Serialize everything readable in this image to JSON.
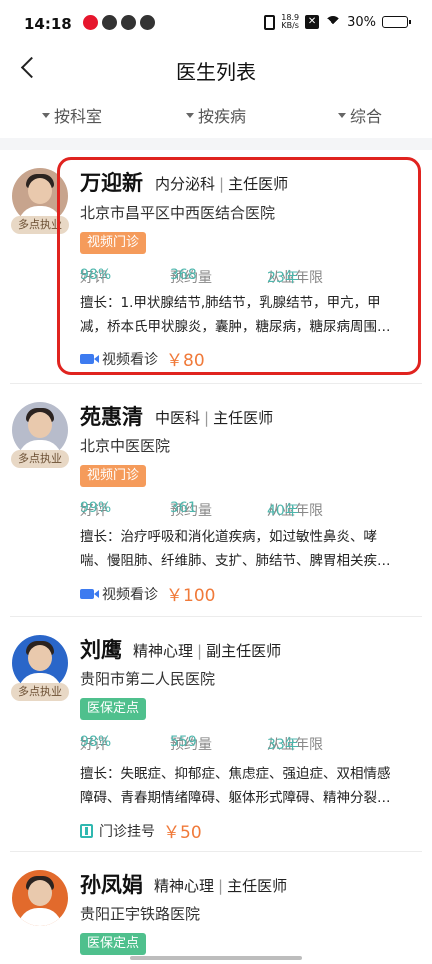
{
  "status_bar": {
    "time": "14:18",
    "net_speed": "18.9",
    "net_unit": "KB/s",
    "battery": "30%",
    "battery_level": 0.3
  },
  "header": {
    "title": "医生列表"
  },
  "filters": [
    {
      "label": "按科室"
    },
    {
      "label": "按疾病"
    },
    {
      "label": "综合"
    }
  ],
  "doctors": [
    {
      "name": "万迎新",
      "department": "内分泌科",
      "title": "主任医师",
      "hospital": "北京市昌平区中西医结合医院",
      "badge": "多点执业",
      "tag": "视频门诊",
      "rating_label": "好评",
      "rating": "98%",
      "appointments_label": "预约量",
      "appointments": "368",
      "years_label": "从业年限",
      "years": "23年",
      "specialty_line1": "擅长：1.甲状腺结节,肺结节，乳腺结节，甲亢，甲",
      "specialty_line2": "减，桥本氏甲状腺炎，囊肿，糖尿病，糖尿病周围…",
      "consult_label": "视频看诊",
      "price": "￥80"
    },
    {
      "name": "苑惠清",
      "department": "中医科",
      "title": "主任医师",
      "hospital": "北京中医医院",
      "badge": "多点执业",
      "tag": "视频门诊",
      "rating_label": "好评",
      "rating": "99%",
      "appointments_label": "预约量",
      "appointments": "361",
      "years_label": "从业年限",
      "years": "40年",
      "specialty_line1": "擅长：治疗呼吸和消化道疾病，如过敏性鼻炎、哮",
      "specialty_line2": "喘、慢阻肺、纤维肺、支扩、肺结节、脾胃相关疾…",
      "consult_label": "视频看诊",
      "price": "￥100"
    },
    {
      "name": "刘鹰",
      "department": "精神心理",
      "title": "副主任医师",
      "hospital": "贵阳市第二人民医院",
      "badge": "多点执业",
      "tag": "医保定点",
      "rating_label": "好评",
      "rating": "98%",
      "appointments_label": "预约量",
      "appointments": "559",
      "years_label": "从业年限",
      "years": "33年",
      "specialty_line1": "擅长：失眠症、抑郁症、焦虑症、强迫症、双相情感",
      "specialty_line2": "障碍、青春期情绪障碍、躯体形式障碍、精神分裂…",
      "consult_label": "门诊挂号",
      "price": "￥50"
    },
    {
      "name": "孙凤娟",
      "department": "精神心理",
      "title": "主任医师",
      "hospital": "贵阳正宇铁路医院",
      "tag": "医保定点"
    }
  ],
  "colors": {
    "highlight": "#e0231f",
    "price": "#f07a3a",
    "stat_value": "#4db6ac",
    "video_tag": "#f59b5b",
    "insurance_tag": "#4fc08d"
  }
}
